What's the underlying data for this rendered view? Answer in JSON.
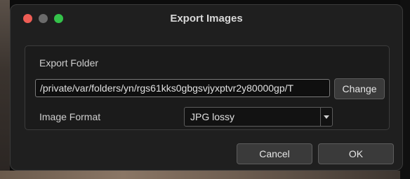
{
  "window": {
    "title": "Export Images"
  },
  "export_folder": {
    "label": "Export Folder",
    "path_value": "/private/var/folders/yn/rgs61kks0gbgsvjyxptvr2y80000gp/T",
    "change_label": "Change"
  },
  "image_format": {
    "label": "Image Format",
    "selected": "JPG lossy"
  },
  "footer": {
    "cancel_label": "Cancel",
    "ok_label": "OK"
  },
  "colors": {
    "close": "#ee5d55",
    "minimize": "#6b6b6b",
    "zoom": "#34c24a"
  }
}
